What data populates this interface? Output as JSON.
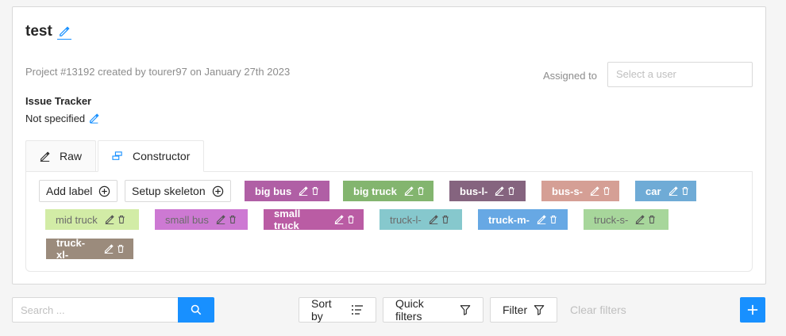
{
  "project": {
    "title": "test",
    "meta": "Project #13192 created by tourer97 on January 27th 2023",
    "assigned_label": "Assigned to",
    "assigned_placeholder": "Select a user",
    "tracker_label": "Issue Tracker",
    "tracker_value": "Not specified"
  },
  "tabs": [
    {
      "label": "Raw",
      "icon": "edit-icon"
    },
    {
      "label": "Constructor",
      "icon": "build-icon"
    }
  ],
  "constructor": {
    "add_label": "Add label",
    "setup_skeleton": "Setup skeleton",
    "labels": [
      {
        "name": "big bus",
        "color": "#b05fa5"
      },
      {
        "name": "big truck",
        "color": "#83b56f"
      },
      {
        "name": "bus-l-",
        "color": "#85647f"
      },
      {
        "name": "bus-s-",
        "color": "#d59f95"
      },
      {
        "name": "car",
        "color": "#6fabd6"
      },
      {
        "name": "mid truck",
        "color": "#d2eca6"
      },
      {
        "name": "small bus",
        "color": "#cd79d3"
      },
      {
        "name": "small truck",
        "color": "#ba5ca4"
      },
      {
        "name": "truck-l-",
        "color": "#86c8cd"
      },
      {
        "name": "truck-m-",
        "color": "#67a8e4"
      },
      {
        "name": "truck-s-",
        "color": "#a7d69b"
      },
      {
        "name": "truck-xl-",
        "color": "#9b8b7c"
      }
    ]
  },
  "toolbar": {
    "search_placeholder": "Search ...",
    "sort_by": "Sort by",
    "quick_filters": "Quick filters",
    "filter": "Filter",
    "clear_filters": "Clear filters"
  }
}
